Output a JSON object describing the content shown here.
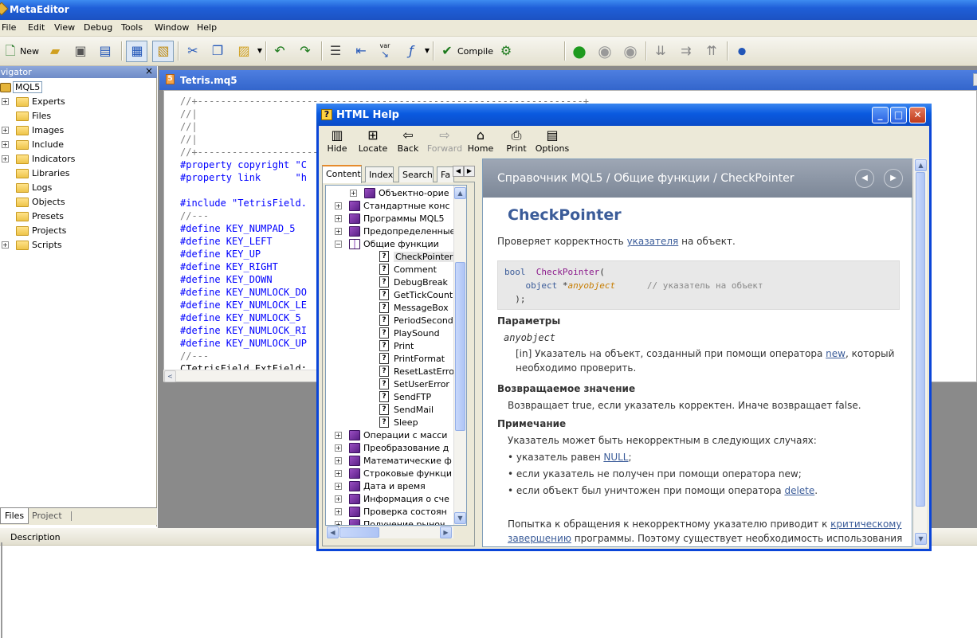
{
  "app": {
    "title": "MetaEditor"
  },
  "menu": [
    "File",
    "Edit",
    "View",
    "Debug",
    "Tools",
    "Window",
    "Help"
  ],
  "toolbar": {
    "new_label": "New",
    "compile_label": "Compile",
    "var_label": "var"
  },
  "navigator": {
    "title": "Navigator",
    "title_visible": "avigator",
    "root": "MQL5",
    "items": [
      {
        "label": "Experts",
        "expandable": true
      },
      {
        "label": "Files",
        "expandable": false
      },
      {
        "label": "Images",
        "expandable": true
      },
      {
        "label": "Include",
        "expandable": true
      },
      {
        "label": "Indicators",
        "expandable": true
      },
      {
        "label": "Libraries",
        "expandable": false
      },
      {
        "label": "Logs",
        "expandable": false
      },
      {
        "label": "Objects",
        "expandable": false
      },
      {
        "label": "Presets",
        "expandable": false
      },
      {
        "label": "Projects",
        "expandable": false
      },
      {
        "label": "Scripts",
        "expandable": true
      }
    ],
    "tabs": [
      "Files",
      "Project"
    ]
  },
  "editor": {
    "tab_title": "Tetris.mq5",
    "lines": [
      {
        "t": "cm",
        "text": "//+-------------------------------------------------------------------+"
      },
      {
        "t": "cm",
        "text": "//|"
      },
      {
        "t": "cm",
        "text": "//|"
      },
      {
        "t": "cm",
        "text": "//|"
      },
      {
        "t": "cm",
        "text": "//+---------------------"
      },
      {
        "t": "kw",
        "text": "#property copyright \"C"
      },
      {
        "t": "kw",
        "text": "#property link      \"h"
      },
      {
        "t": "",
        "text": ""
      },
      {
        "t": "inc",
        "text": "#include \"TetrisField."
      },
      {
        "t": "cm",
        "text": "//---"
      },
      {
        "t": "def",
        "text": "#define KEY_NUMPAD_5"
      },
      {
        "t": "def",
        "text": "#define KEY_LEFT"
      },
      {
        "t": "def",
        "text": "#define KEY_UP"
      },
      {
        "t": "def",
        "text": "#define KEY_RIGHT"
      },
      {
        "t": "def",
        "text": "#define KEY_DOWN"
      },
      {
        "t": "def",
        "text": "#define KEY_NUMLOCK_DO"
      },
      {
        "t": "def",
        "text": "#define KEY_NUMLOCK_LE"
      },
      {
        "t": "def",
        "text": "#define KEY_NUMLOCK_5"
      },
      {
        "t": "def",
        "text": "#define KEY_NUMLOCK_RI"
      },
      {
        "t": "def",
        "text": "#define KEY_NUMLOCK_UP"
      },
      {
        "t": "cm",
        "text": "//---"
      },
      {
        "t": "tx",
        "text": "CTetrisField ExtField;"
      }
    ]
  },
  "description": {
    "header": "Description"
  },
  "help": {
    "title": "HTML Help",
    "buttons": [
      "Hide",
      "Locate",
      "Back",
      "Forward",
      "Home",
      "Print",
      "Options"
    ],
    "tabs": [
      "Contents",
      "Index",
      "Search",
      "Fa"
    ],
    "tree": [
      {
        "label": "Объектно-орие",
        "icon": "book",
        "indent": 1,
        "expander": "+"
      },
      {
        "label": "Стандартные конс",
        "icon": "book",
        "indent": 0,
        "expander": "+"
      },
      {
        "label": "Программы MQL5",
        "icon": "book",
        "indent": 0,
        "expander": "+"
      },
      {
        "label": "Предопределенные",
        "icon": "book",
        "indent": 0,
        "expander": "+"
      },
      {
        "label": "Общие функции",
        "icon": "openbook",
        "indent": 0,
        "expander": "−"
      },
      {
        "label": "CheckPointer",
        "icon": "page",
        "indent": 2,
        "expander": "",
        "selected": true
      },
      {
        "label": "Comment",
        "icon": "page",
        "indent": 2,
        "expander": ""
      },
      {
        "label": "DebugBreak",
        "icon": "page",
        "indent": 2,
        "expander": ""
      },
      {
        "label": "GetTickCount",
        "icon": "page",
        "indent": 2,
        "expander": ""
      },
      {
        "label": "MessageBox",
        "icon": "page",
        "indent": 2,
        "expander": ""
      },
      {
        "label": "PeriodSeconds",
        "icon": "page",
        "indent": 2,
        "expander": ""
      },
      {
        "label": "PlaySound",
        "icon": "page",
        "indent": 2,
        "expander": ""
      },
      {
        "label": "Print",
        "icon": "page",
        "indent": 2,
        "expander": ""
      },
      {
        "label": "PrintFormat",
        "icon": "page",
        "indent": 2,
        "expander": ""
      },
      {
        "label": "ResetLastError",
        "icon": "page",
        "indent": 2,
        "expander": ""
      },
      {
        "label": "SetUserError",
        "icon": "page",
        "indent": 2,
        "expander": ""
      },
      {
        "label": "SendFTP",
        "icon": "page",
        "indent": 2,
        "expander": ""
      },
      {
        "label": "SendMail",
        "icon": "page",
        "indent": 2,
        "expander": ""
      },
      {
        "label": "Sleep",
        "icon": "page",
        "indent": 2,
        "expander": ""
      },
      {
        "label": "Операции с масси",
        "icon": "book",
        "indent": 0,
        "expander": "+"
      },
      {
        "label": "Преобразование д",
        "icon": "book",
        "indent": 0,
        "expander": "+"
      },
      {
        "label": "Математические ф",
        "icon": "book",
        "indent": 0,
        "expander": "+"
      },
      {
        "label": "Строковые функци",
        "icon": "book",
        "indent": 0,
        "expander": "+"
      },
      {
        "label": "Дата и время",
        "icon": "book",
        "indent": 0,
        "expander": "+"
      },
      {
        "label": "Информация о сче",
        "icon": "book",
        "indent": 0,
        "expander": "+"
      },
      {
        "label": "Проверка состоян",
        "icon": "book",
        "indent": 0,
        "expander": "+"
      },
      {
        "label": "Получение рыноч",
        "icon": "book",
        "indent": 0,
        "expander": "+"
      }
    ],
    "content": {
      "breadcrumb": "Справочник MQL5 / Общие функции / CheckPointer",
      "heading": "CheckPointer",
      "intro_pre": "Проверяет корректность ",
      "intro_link": "указателя",
      "intro_post": " на объект.",
      "code_l1_type": "bool",
      "code_l1_fn": "CheckPointer",
      "code_l1_paren": "(",
      "code_l2_type": "object",
      "code_l2_star": " *",
      "code_l2_arg": "anyobject",
      "code_l2_comment": "// указатель на объект",
      "code_l3": "  );",
      "params_header": "Параметры",
      "param_name": "anyobject",
      "param_desc_pre": "[in]  Указатель на объект, созданный при помощи оператора ",
      "param_desc_link": "new",
      "param_desc_post": ", который",
      "param_desc_2": "необходимо проверить.",
      "return_header": "Возвращаемое значение",
      "return_text": "Возвращает true, если указатель корректен. Иначе возвращает false.",
      "note_header": "Примечание",
      "note_text": "Указатель может быть некорректным в следующих случаях:",
      "bullet1_pre": "указатель равен ",
      "bullet1_link": "NULL",
      "bullet1_post": ";",
      "bullet2": "если указатель не получен при помощи оператора new;",
      "bullet3_pre": "если объект был уничтожен при помощи оператора ",
      "bullet3_link": "delete",
      "bullet3_post": ".",
      "footer1_pre": "Попытка к обращения к некорректному указателю приводит к ",
      "footer1_link": "критическому",
      "footer2_link": "завершению",
      "footer2_post": " программы. Поэтому существует необходимость использования"
    }
  },
  "colors": {
    "title_blue": "#1f5fd8",
    "link": "#3b5c99",
    "heading": "#3b5c99",
    "keyword": "#0000ff",
    "comment": "#808080"
  }
}
